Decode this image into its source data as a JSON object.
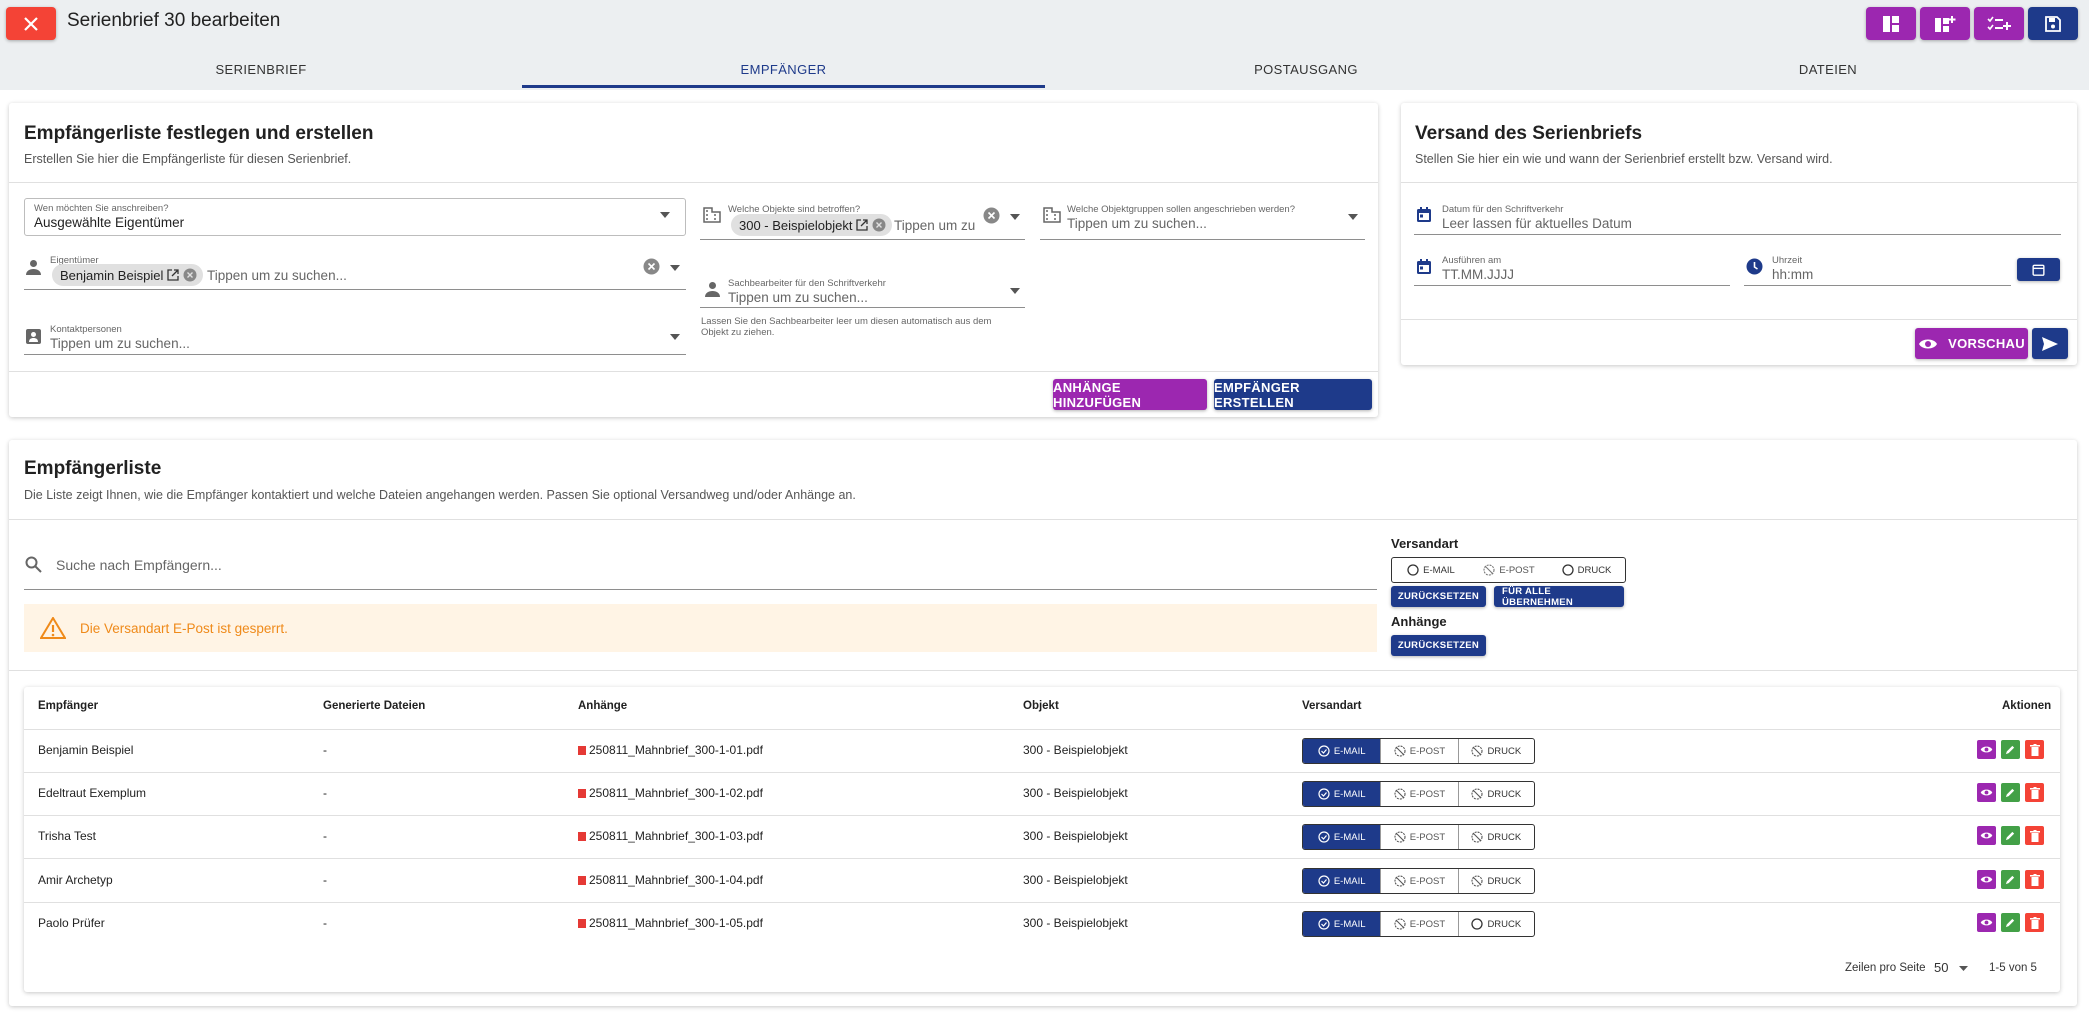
{
  "header": {
    "title": "Serienbrief 30 bearbeiten",
    "tabs": [
      "Serienbrief",
      "Empfänger",
      "Postausgang",
      "Dateien"
    ],
    "active_tab": "Empfänger"
  },
  "colors": {
    "primary": "#1e3a8a",
    "purple": "#9c27b0",
    "danger": "#f44336",
    "success": "#43a047",
    "warning": "#ef8a1a"
  },
  "recipients_setup": {
    "title": "Empfängerliste festlegen und erstellen",
    "subtitle": "Erstellen Sie hier die Empfängerliste für diesen Serienbrief.",
    "whom_label": "Wen möchten Sie anschreiben?",
    "whom_value": "Ausgewählte Eigentümer",
    "objects_label": "Welche Objekte sind betroffen?",
    "objects_chip": "300 - Beispielobjekt",
    "objects_placeholder": "Tippen um zu",
    "groups_label": "Welche Objektgruppen sollen angeschrieben werden?",
    "groups_placeholder": "Tippen um zu suchen...",
    "owners_label": "Eigentümer",
    "owners_chip": "Benjamin Beispiel",
    "owners_placeholder": "Tippen um zu suchen...",
    "clerk_label": "Sachbearbeiter für den Schriftverkehr",
    "clerk_placeholder": "Tippen um zu suchen...",
    "clerk_hint": "Lassen Sie den Sachbearbeiter leer um diesen automatisch aus dem Objekt zu ziehen.",
    "contacts_label": "Kontaktpersonen",
    "contacts_placeholder": "Tippen um zu suchen...",
    "add_attachments": "Anhänge hinzufügen",
    "create_recipients": "Empfänger erstellen"
  },
  "dispatch": {
    "title": "Versand des Serienbriefs",
    "subtitle": "Stellen Sie hier ein wie und wann der Serienbrief erstellt bzw. Versand wird.",
    "date_label": "Datum für den Schriftverkehr",
    "date_placeholder": "Leer lassen für aktuelles Datum",
    "execute_label": "Ausführen am",
    "execute_placeholder": "TT.MM.JJJJ",
    "time_label": "Uhrzeit",
    "time_placeholder": "hh:mm",
    "preview": "Vorschau"
  },
  "list": {
    "title": "Empfängerliste",
    "subtitle": "Die Liste zeigt Ihnen, wie die Empfänger kontaktiert und welche Dateien angehangen werden. Passen Sie optional Versandweg und/oder Anhänge an.",
    "search_placeholder": "Suche nach Empfängern...",
    "warning": "Die Versandart E-Post ist gesperrt.",
    "versandart_heading": "Versandart",
    "versandart_options": [
      "E-Mail",
      "E-Post",
      "Druck"
    ],
    "reset": "Zurücksetzen",
    "apply_all": "Für alle übernehmen",
    "attachments_heading": "Anhänge",
    "reset_attachments": "Zurücksetzen"
  },
  "table": {
    "columns": [
      "Empfänger",
      "Generierte Dateien",
      "Anhänge",
      "Objekt",
      "Versandart",
      "Aktionen"
    ],
    "rows": [
      {
        "name": "Benjamin Beispiel",
        "files": "-",
        "attachment": "250811_Mahnbrief_300-1-01.pdf",
        "object": "300 - Beispielobjekt",
        "mode": [
          "E-Mail",
          "E-Post",
          "Druck"
        ]
      },
      {
        "name": "Edeltraut Exemplum",
        "files": "-",
        "attachment": "250811_Mahnbrief_300-1-02.pdf",
        "object": "300 - Beispielobjekt",
        "mode": [
          "E-Mail",
          "E-Post",
          "Druck"
        ]
      },
      {
        "name": "Trisha Test",
        "files": "-",
        "attachment": "250811_Mahnbrief_300-1-03.pdf",
        "object": "300 - Beispielobjekt",
        "mode": [
          "E-Mail",
          "E-Post",
          "Druck"
        ]
      },
      {
        "name": "Amir Archetyp",
        "files": "-",
        "attachment": "250811_Mahnbrief_300-1-04.pdf",
        "object": "300 - Beispielobjekt",
        "mode": [
          "E-Mail",
          "E-Post",
          "Druck"
        ]
      },
      {
        "name": "Paolo Prüfer",
        "files": "-",
        "attachment": "250811_Mahnbrief_300-1-05.pdf",
        "object": "300 - Beispielobjekt",
        "mode": [
          "E-Mail",
          "E-Post",
          "Druck"
        ]
      }
    ],
    "rows_per_page_label": "Zeilen pro Seite",
    "rows_per_page": "50",
    "range": "1-5 von 5"
  }
}
